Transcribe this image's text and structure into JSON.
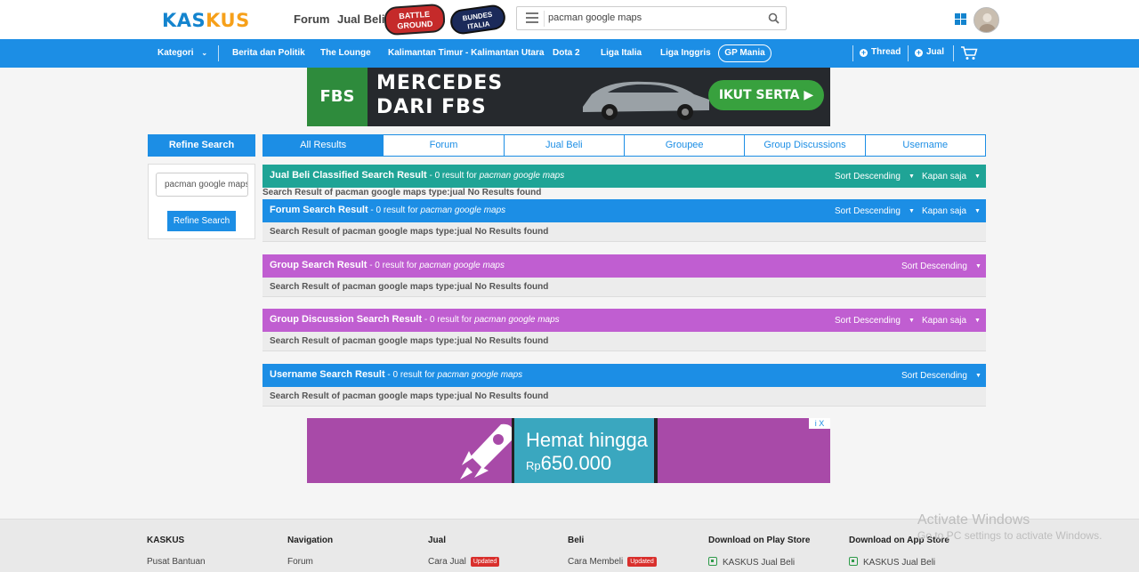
{
  "header": {
    "logo": {
      "part1": "KAS",
      "part2": "KUS"
    },
    "nav": [
      "Forum",
      "Jual Beli"
    ],
    "badges": {
      "battleground": "BATTLE GROUND",
      "bundesliga": "BUNDES ITALIA"
    },
    "search_query": "pacman google maps"
  },
  "bluebar": {
    "kategori": "Kategori",
    "links": [
      "Berita dan Politik",
      "The Lounge",
      "Kalimantan Timur - Kalimantan Utara",
      "Dota 2",
      "Liga Italia",
      "Liga Inggris"
    ],
    "gp_mania": "GP Mania",
    "thread": "Thread",
    "jual": "Jual"
  },
  "top_ad": {
    "logo": "FBS",
    "line1": "MERCEDES",
    "line2": "DARI FBS",
    "cta": "IKUT SERTA"
  },
  "refine": {
    "header": "Refine Search",
    "input_value": "pacman google maps",
    "button": "Refine Search"
  },
  "tabs": [
    "All Results",
    "Forum",
    "Jual Beli",
    "Groupee",
    "Group Discussions",
    "Username"
  ],
  "results": {
    "jualbeli": {
      "title": "Jual Beli Classified Search Result",
      "count": " - 0 result for ",
      "query": "pacman google maps",
      "sort": "Sort Descending",
      "time": "Kapan saja",
      "body": "Search Result of pacman google maps type:jual No Results found"
    },
    "forum": {
      "title": "Forum Search Result",
      "count": " - 0 result for ",
      "query": "pacman google maps",
      "sort": "Sort Descending",
      "time": "Kapan saja",
      "body": "Search Result of pacman google maps type:jual No Results found"
    },
    "group": {
      "title": "Group Search Result",
      "count": " - 0 result for ",
      "query": "pacman google maps",
      "sort": "Sort Descending",
      "body": "Search Result of pacman google maps type:jual No Results found"
    },
    "groupdisc": {
      "title": "Group Discussion Search Result",
      "count": " - 0 result for ",
      "query": "pacman google maps",
      "sort": "Sort Descending",
      "time": "Kapan saja",
      "body": "Search Result of pacman google maps type:jual No Results found"
    },
    "username": {
      "title": "Username Search Result",
      "count": " - 0 result for ",
      "query": "pacman google maps",
      "sort": "Sort Descending",
      "body": "Search Result of pacman google maps type:jual No Results found"
    }
  },
  "bottom_ad": {
    "line1": "Hemat hingga",
    "currency": "Rp",
    "amount": "650.000",
    "adchoice": "i X"
  },
  "footer": {
    "cols": [
      {
        "heading": "KASKUS",
        "link": "Pusat Bantuan"
      },
      {
        "heading": "Navigation",
        "link": "Forum"
      },
      {
        "heading": "Jual",
        "link": "Cara Jual",
        "tag": "Updated"
      },
      {
        "heading": "Beli",
        "link": "Cara Membeli",
        "tag": "Updated"
      },
      {
        "heading": "Download on Play Store",
        "link": "KASKUS Jual Beli"
      },
      {
        "heading": "Download on App Store",
        "link": "KASKUS Jual Beli"
      }
    ]
  },
  "watermark": {
    "line1": "Activate Windows",
    "line2": "Go to PC settings to activate Windows."
  },
  "colors": {
    "primary": "#1c8ee5",
    "teal": "#1fa496",
    "purple": "#c05ed1",
    "updated": "#d9302d"
  }
}
